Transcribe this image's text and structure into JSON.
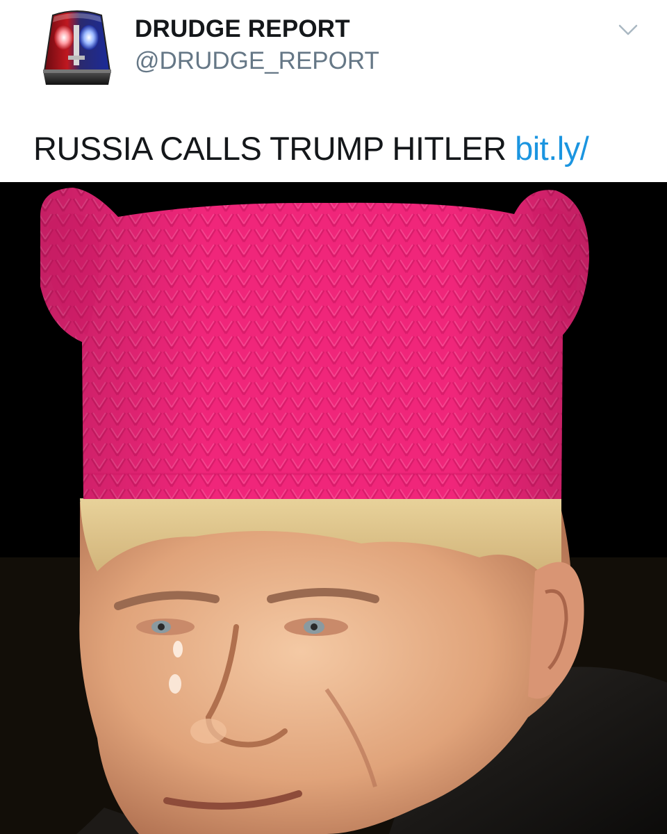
{
  "tweet": {
    "account": {
      "display_name": "DRUDGE REPORT",
      "handle": "@DRUDGE_REPORT",
      "avatar_icon": "siren-icon"
    },
    "menu_icon": "chevron-down-icon",
    "text": "RUSSIA CALLS TRUMP HITLER",
    "link_text": "bit.ly/",
    "colors": {
      "text": "#14171a",
      "handle": "#657786",
      "link": "#1b95e0",
      "hat_pink": "#f0267a",
      "media_background": "#000000"
    }
  }
}
